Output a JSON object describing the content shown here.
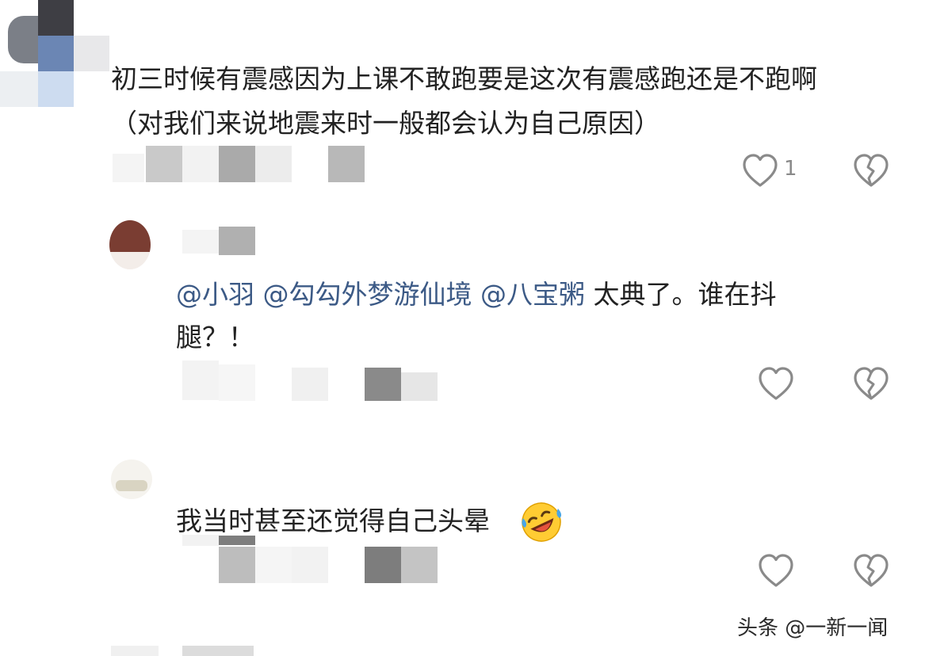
{
  "comments": [
    {
      "line1": "初三时候有震感因为上课不敢跑要是这次有震感跑还是不跑啊",
      "line2": "（对我们来说地震来时一般都会认为自己原因）",
      "like_count": "1"
    },
    {
      "mentions": [
        "@小羽",
        "@勾勾外梦游仙境",
        "@八宝粥"
      ],
      "text_after": "太典了。谁在抖",
      "line2": "腿？！"
    },
    {
      "text": "我当时甚至还觉得自己头晕",
      "emoji": "rolling-on-floor-laughing"
    }
  ],
  "icons": {
    "like": "heart-outline-icon",
    "dislike": "broken-heart-icon"
  },
  "watermark": "头条 @一新一闻",
  "colors": {
    "mention": "#3c5a86",
    "text": "#222222",
    "icon": "#8a8a8a"
  }
}
